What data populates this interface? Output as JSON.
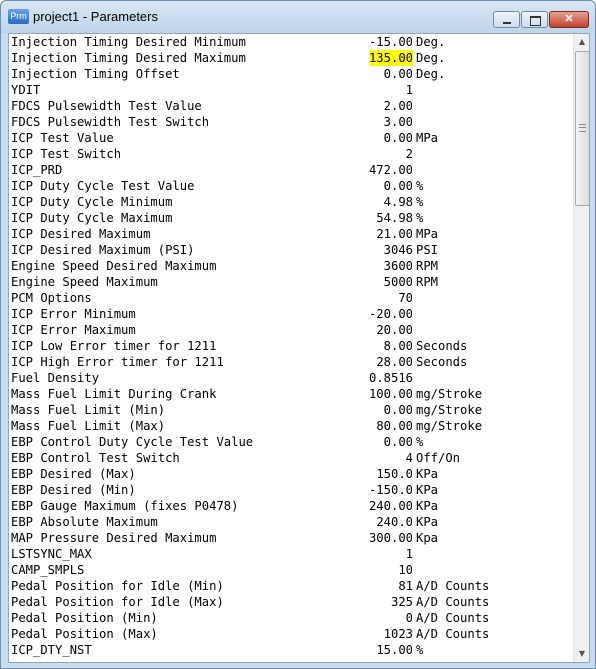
{
  "window": {
    "title": "project1 - Parameters",
    "icon_label": "Prm",
    "buttons": {
      "minimize": "minimize-icon",
      "maximize": "maximize-icon",
      "close": "✕"
    }
  },
  "parameters": [
    {
      "name": "Injection Timing Desired Minimum",
      "value": "-15.00",
      "unit": "Deg."
    },
    {
      "name": "Injection Timing Desired Maximum",
      "value": "135.00",
      "unit": "Deg.",
      "highlight": true
    },
    {
      "name": "Injection Timing Offset",
      "value": "0.00",
      "unit": "Deg."
    },
    {
      "name": "YDIT",
      "value": "1",
      "unit": ""
    },
    {
      "name": "FDCS Pulsewidth Test Value",
      "value": "2.00",
      "unit": ""
    },
    {
      "name": "FDCS Pulsewidth Test Switch",
      "value": "3.00",
      "unit": ""
    },
    {
      "name": "ICP Test Value",
      "value": "0.00",
      "unit": "MPa"
    },
    {
      "name": "ICP Test Switch",
      "value": "2",
      "unit": ""
    },
    {
      "name": "ICP_PRD",
      "value": "472.00",
      "unit": ""
    },
    {
      "name": "ICP Duty Cycle Test Value",
      "value": "0.00",
      "unit": "%"
    },
    {
      "name": "ICP Duty Cycle Minimum",
      "value": "4.98",
      "unit": "%"
    },
    {
      "name": "ICP Duty Cycle Maximum",
      "value": "54.98",
      "unit": "%"
    },
    {
      "name": "ICP Desired Maximum",
      "value": "21.00",
      "unit": "MPa"
    },
    {
      "name": "ICP Desired Maximum (PSI)",
      "value": "3046",
      "unit": "PSI"
    },
    {
      "name": "Engine Speed Desired Maximum",
      "value": "3600",
      "unit": "RPM"
    },
    {
      "name": "Engine Speed Maximum",
      "value": "5000",
      "unit": "RPM"
    },
    {
      "name": "PCM Options",
      "value": "70",
      "unit": ""
    },
    {
      "name": "ICP Error Minimum",
      "value": "-20.00",
      "unit": ""
    },
    {
      "name": "ICP Error Maximum",
      "value": "20.00",
      "unit": ""
    },
    {
      "name": "ICP Low Error timer for 1211",
      "value": "8.00",
      "unit": "Seconds"
    },
    {
      "name": "ICP High Error timer for 1211",
      "value": "28.00",
      "unit": "Seconds"
    },
    {
      "name": "Fuel Density",
      "value": "0.8516",
      "unit": ""
    },
    {
      "name": "Mass Fuel Limit During Crank",
      "value": "100.00",
      "unit": "mg/Stroke"
    },
    {
      "name": "Mass Fuel Limit (Min)",
      "value": "0.00",
      "unit": "mg/Stroke"
    },
    {
      "name": "Mass Fuel Limit (Max)",
      "value": "80.00",
      "unit": "mg/Stroke"
    },
    {
      "name": "EBP Control Duty Cycle Test Value",
      "value": "0.00",
      "unit": "%"
    },
    {
      "name": "EBP Control Test Switch",
      "value": "4",
      "unit": "Off/On"
    },
    {
      "name": "EBP Desired (Max)",
      "value": "150.0",
      "unit": "KPa"
    },
    {
      "name": "EBP Desired (Min)",
      "value": "-150.0",
      "unit": "KPa"
    },
    {
      "name": "EBP Gauge Maximum (fixes P0478)",
      "value": "240.00",
      "unit": "KPa"
    },
    {
      "name": "EBP Absolute Maximum",
      "value": "240.0",
      "unit": "KPa"
    },
    {
      "name": "MAP Pressure Desired Maximum",
      "value": "300.00",
      "unit": "Kpa"
    },
    {
      "name": "LSTSYNC_MAX",
      "value": "1",
      "unit": ""
    },
    {
      "name": "CAMP_SMPLS",
      "value": "10",
      "unit": ""
    },
    {
      "name": "Pedal Position for Idle (Min)",
      "value": "81",
      "unit": "A/D Counts"
    },
    {
      "name": "Pedal Position for Idle (Max)",
      "value": "325",
      "unit": "A/D Counts"
    },
    {
      "name": "Pedal Position (Min)",
      "value": "0",
      "unit": "A/D Counts"
    },
    {
      "name": "Pedal Position (Max)",
      "value": "1023",
      "unit": "A/D Counts"
    },
    {
      "name": "ICP_DTY_NST",
      "value": "15.00",
      "unit": "%"
    }
  ],
  "scrollbar": {
    "up": "▲",
    "down": "▼",
    "position_fraction": 0.0
  },
  "colors": {
    "highlight": "#ffff00",
    "title_bg": "#c9dbee",
    "close": "#c4402b"
  }
}
